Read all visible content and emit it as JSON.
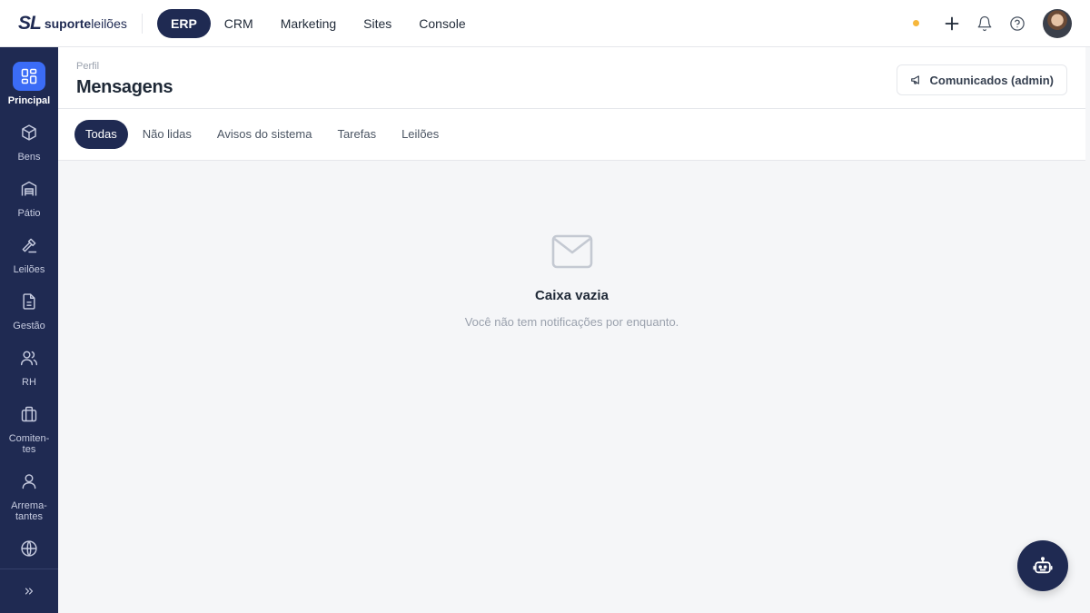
{
  "brand": {
    "mark": "SL",
    "name_bold": "suporte",
    "name_light": "leilões"
  },
  "modules": [
    {
      "label": "ERP",
      "active": true
    },
    {
      "label": "CRM",
      "active": false
    },
    {
      "label": "Marketing",
      "active": false
    },
    {
      "label": "Sites",
      "active": false
    },
    {
      "label": "Console",
      "active": false
    }
  ],
  "topbar_icons": [
    "status-dot",
    "plus-icon",
    "bell-icon",
    "help-icon",
    "avatar"
  ],
  "sidebar": {
    "items": [
      {
        "label": "Principal",
        "icon": "grid-icon",
        "active": true
      },
      {
        "label": "Bens",
        "icon": "box-icon"
      },
      {
        "label": "Pátio",
        "icon": "warehouse-icon"
      },
      {
        "label": "Leilões",
        "icon": "gavel-icon"
      },
      {
        "label": "Gestão",
        "icon": "document-icon"
      },
      {
        "label": "RH",
        "icon": "users-icon"
      },
      {
        "label": "Comiten-\ntes",
        "icon": "briefcase-icon"
      },
      {
        "label": "Arrema-\ntantes",
        "icon": "user-icon"
      },
      {
        "label": "",
        "icon": "globe-icon"
      }
    ],
    "footer_icon": "chevrons-right-icon"
  },
  "header": {
    "breadcrumb": "Perfil",
    "title": "Mensagens",
    "action_label": "Comunicados (admin)",
    "action_icon": "megaphone-icon"
  },
  "tabs": [
    {
      "label": "Todas",
      "active": true
    },
    {
      "label": "Não lidas"
    },
    {
      "label": "Avisos do sistema"
    },
    {
      "label": "Tarefas"
    },
    {
      "label": "Leilões"
    }
  ],
  "empty_state": {
    "icon": "mail-icon",
    "title": "Caixa vazia",
    "subtitle": "Você não tem notificações por enquanto."
  },
  "fab_icon": "robot-icon",
  "colors": {
    "navy": "#1f2a52",
    "accent": "#3b6cf6",
    "status": "#f6b73c"
  }
}
